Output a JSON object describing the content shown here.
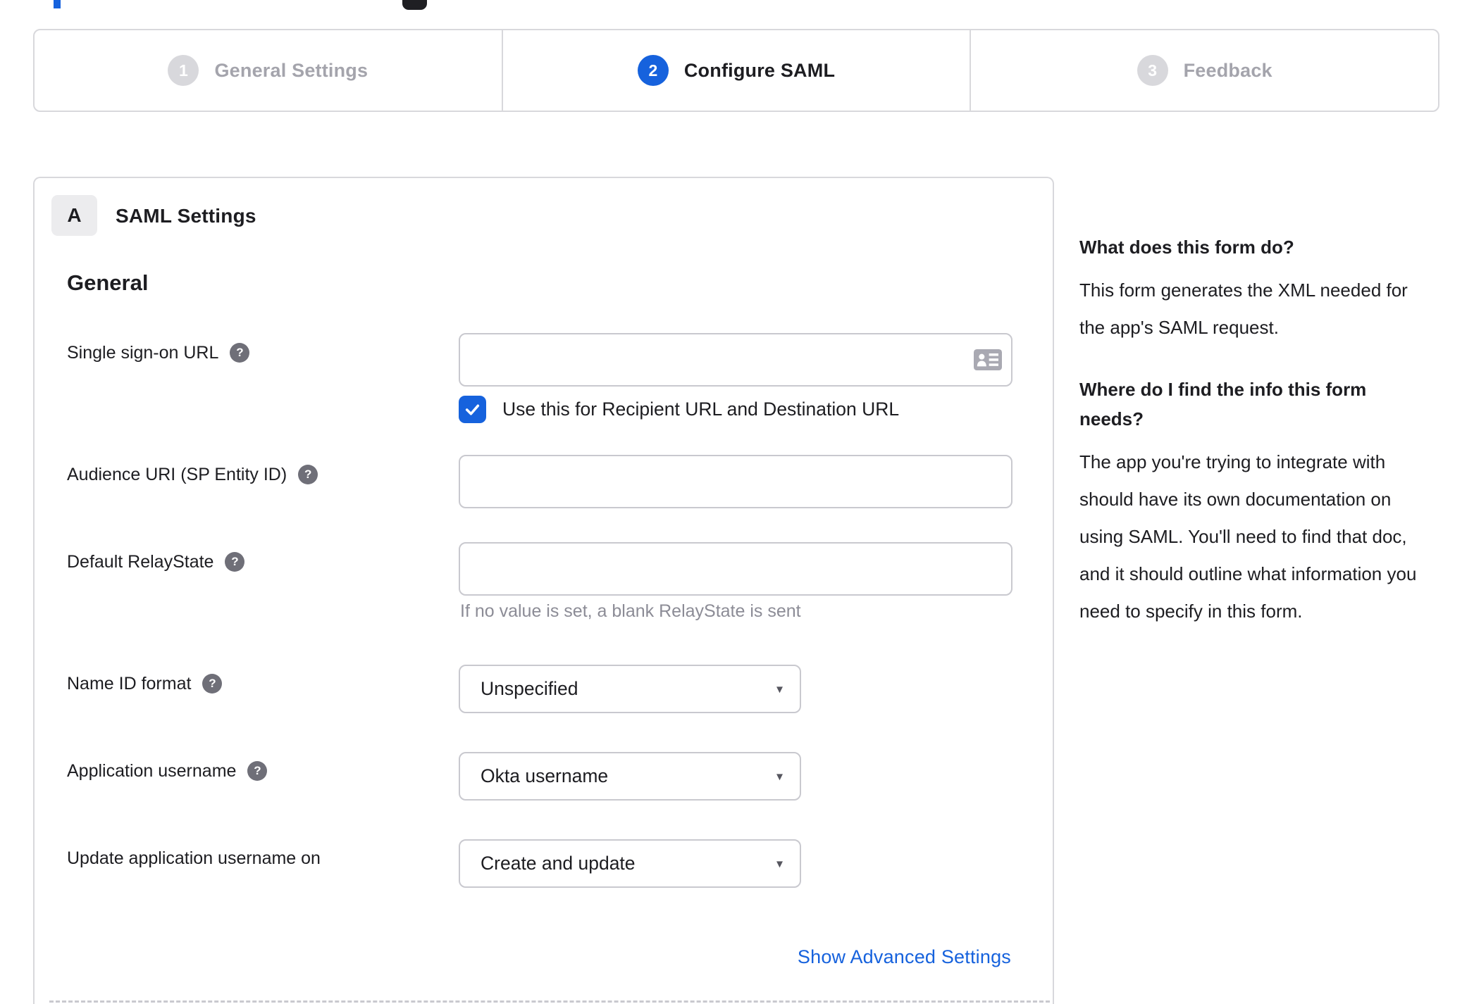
{
  "colors": {
    "accent": "#1662dd",
    "border": "#d8d8dc",
    "input_border": "#c9c9cf",
    "text": "#1d1d21",
    "muted": "#a4a4ac",
    "hint": "#8c8c96",
    "help_icon_bg": "#6f6f78"
  },
  "icons": {
    "help": "?",
    "caret": "▾",
    "check": "check-mark",
    "contact_card": "contact-card"
  },
  "stepper": {
    "steps": [
      {
        "number": "1",
        "label": "General Settings",
        "state": "inactive"
      },
      {
        "number": "2",
        "label": "Configure SAML",
        "state": "active"
      },
      {
        "number": "3",
        "label": "Feedback",
        "state": "inactive"
      }
    ]
  },
  "card": {
    "section_badge": "A",
    "section_title": "SAML Settings",
    "group_heading": "General",
    "advanced_link": "Show Advanced Settings"
  },
  "form": {
    "sso": {
      "label": "Single sign-on URL",
      "value": "",
      "checkbox_label": "Use this for Recipient URL and Destination URL",
      "checked": true
    },
    "audience": {
      "label": "Audience URI (SP Entity ID)",
      "value": ""
    },
    "relay": {
      "label": "Default RelayState",
      "value": "",
      "hint": "If no value is set, a blank RelayState is sent"
    },
    "name_id_format": {
      "label": "Name ID format",
      "value": "Unspecified"
    },
    "app_username": {
      "label": "Application username",
      "value": "Okta username"
    },
    "update_app_username": {
      "label": "Update application username on",
      "value": "Create and update"
    }
  },
  "help_panel": {
    "q1": "What does this form do?",
    "a1": "This form generates the XML needed for the app's SAML request.",
    "q2": "Where do I find the info this form needs?",
    "a2": "The app you're trying to integrate with should have its own documentation on using SAML. You'll need to find that doc, and it should outline what information you need to specify in this form."
  }
}
